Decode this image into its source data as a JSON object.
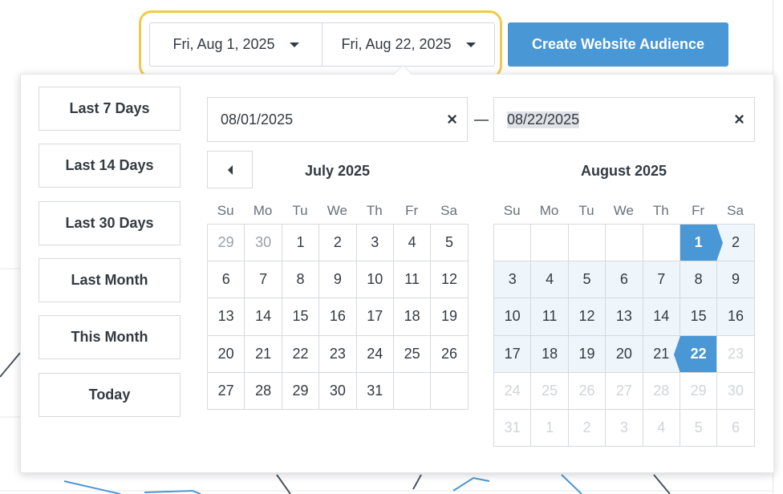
{
  "range": {
    "start_label": "Fri, Aug 1, 2025",
    "end_label": "Fri, Aug 22, 2025"
  },
  "create_button": "Create Website Audience",
  "colors": {
    "accent": "#4a97d6",
    "highlight": "#f1c94c"
  },
  "presets": [
    "Last 7 Days",
    "Last 14 Days",
    "Last 30 Days",
    "Last Month",
    "This Month",
    "Today"
  ],
  "inputs": {
    "start_value": "08/01/2025",
    "end_value": "08/22/2025",
    "clear_icon": "×"
  },
  "weekdays": [
    "Su",
    "Mo",
    "Tu",
    "We",
    "Th",
    "Fr",
    "Sa"
  ],
  "calendars": [
    {
      "title": "July 2025",
      "weeks": [
        [
          {
            "d": "29",
            "s": "muted"
          },
          {
            "d": "30",
            "s": "muted"
          },
          {
            "d": "1"
          },
          {
            "d": "2"
          },
          {
            "d": "3"
          },
          {
            "d": "4"
          },
          {
            "d": "5"
          }
        ],
        [
          {
            "d": "6"
          },
          {
            "d": "7"
          },
          {
            "d": "8"
          },
          {
            "d": "9"
          },
          {
            "d": "10"
          },
          {
            "d": "11"
          },
          {
            "d": "12"
          }
        ],
        [
          {
            "d": "13"
          },
          {
            "d": "14"
          },
          {
            "d": "15"
          },
          {
            "d": "16"
          },
          {
            "d": "17"
          },
          {
            "d": "18"
          },
          {
            "d": "19"
          }
        ],
        [
          {
            "d": "20"
          },
          {
            "d": "21"
          },
          {
            "d": "22"
          },
          {
            "d": "23"
          },
          {
            "d": "24"
          },
          {
            "d": "25"
          },
          {
            "d": "26"
          }
        ],
        [
          {
            "d": "27"
          },
          {
            "d": "28"
          },
          {
            "d": "29"
          },
          {
            "d": "30"
          },
          {
            "d": "31"
          },
          {
            "d": "",
            "s": "empty"
          },
          {
            "d": "",
            "s": "empty"
          }
        ]
      ]
    },
    {
      "title": "August 2025",
      "weeks": [
        [
          {
            "d": "",
            "s": "empty"
          },
          {
            "d": "",
            "s": "empty"
          },
          {
            "d": "",
            "s": "empty"
          },
          {
            "d": "",
            "s": "empty"
          },
          {
            "d": "",
            "s": "empty"
          },
          {
            "d": "1",
            "s": "start"
          },
          {
            "d": "2",
            "s": "inrange"
          }
        ],
        [
          {
            "d": "3",
            "s": "inrange"
          },
          {
            "d": "4",
            "s": "inrange"
          },
          {
            "d": "5",
            "s": "inrange"
          },
          {
            "d": "6",
            "s": "inrange"
          },
          {
            "d": "7",
            "s": "inrange"
          },
          {
            "d": "8",
            "s": "inrange"
          },
          {
            "d": "9",
            "s": "inrange"
          }
        ],
        [
          {
            "d": "10",
            "s": "inrange"
          },
          {
            "d": "11",
            "s": "inrange"
          },
          {
            "d": "12",
            "s": "inrange"
          },
          {
            "d": "13",
            "s": "inrange"
          },
          {
            "d": "14",
            "s": "inrange"
          },
          {
            "d": "15",
            "s": "inrange"
          },
          {
            "d": "16",
            "s": "inrange"
          }
        ],
        [
          {
            "d": "17",
            "s": "inrange"
          },
          {
            "d": "18",
            "s": "inrange"
          },
          {
            "d": "19",
            "s": "inrange"
          },
          {
            "d": "20",
            "s": "inrange"
          },
          {
            "d": "21",
            "s": "inrange"
          },
          {
            "d": "22",
            "s": "end"
          },
          {
            "d": "23",
            "s": "disabled"
          }
        ],
        [
          {
            "d": "24",
            "s": "disabled"
          },
          {
            "d": "25",
            "s": "disabled"
          },
          {
            "d": "26",
            "s": "disabled"
          },
          {
            "d": "27",
            "s": "disabled"
          },
          {
            "d": "28",
            "s": "disabled"
          },
          {
            "d": "29",
            "s": "disabled"
          },
          {
            "d": "30",
            "s": "disabled"
          }
        ],
        [
          {
            "d": "31",
            "s": "disabled"
          },
          {
            "d": "1",
            "s": "disabled"
          },
          {
            "d": "2",
            "s": "disabled"
          },
          {
            "d": "3",
            "s": "disabled"
          },
          {
            "d": "4",
            "s": "disabled"
          },
          {
            "d": "5",
            "s": "disabled"
          },
          {
            "d": "6",
            "s": "disabled"
          }
        ]
      ]
    }
  ]
}
